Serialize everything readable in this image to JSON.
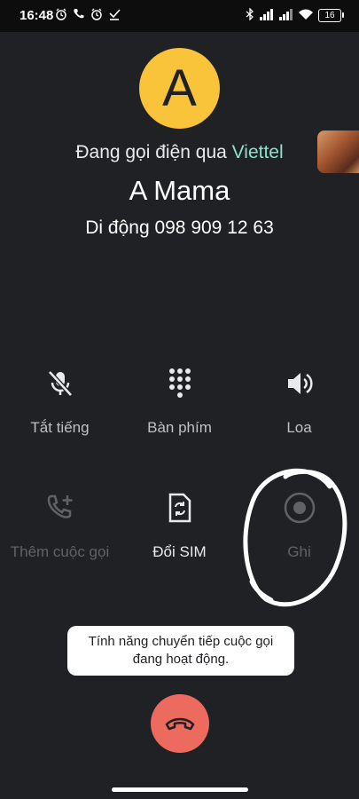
{
  "status_bar": {
    "time": "16:48",
    "battery": "16",
    "left_icons": [
      "alarm-icon",
      "phone-icon",
      "alarm-icon",
      "download-icon"
    ],
    "right_icons": [
      "bluetooth-icon",
      "signal-icon",
      "signal-r-icon",
      "wifi-icon",
      "battery-icon"
    ]
  },
  "call": {
    "avatar_letter": "A",
    "avatar_color": "#f9c33a",
    "calling_via_prefix": "Đang gọi điện qua ",
    "carrier": "Viettel",
    "carrier_color": "#8ee0cf",
    "contact_name": "A Mama",
    "contact_number": "Di động 098 909 12 63"
  },
  "controls": {
    "mute_label": "Tắt tiếng",
    "keypad_label": "Bàn phím",
    "speaker_label": "Loa",
    "add_call_label": "Thêm cuộc gọi",
    "switch_sim_label": "Đổi SIM",
    "record_label": "Ghi"
  },
  "toast": {
    "text": "Tính năng chuyển tiếp cuộc gọi đang hoạt động."
  },
  "end_call": {
    "color": "#ec6a5e"
  }
}
